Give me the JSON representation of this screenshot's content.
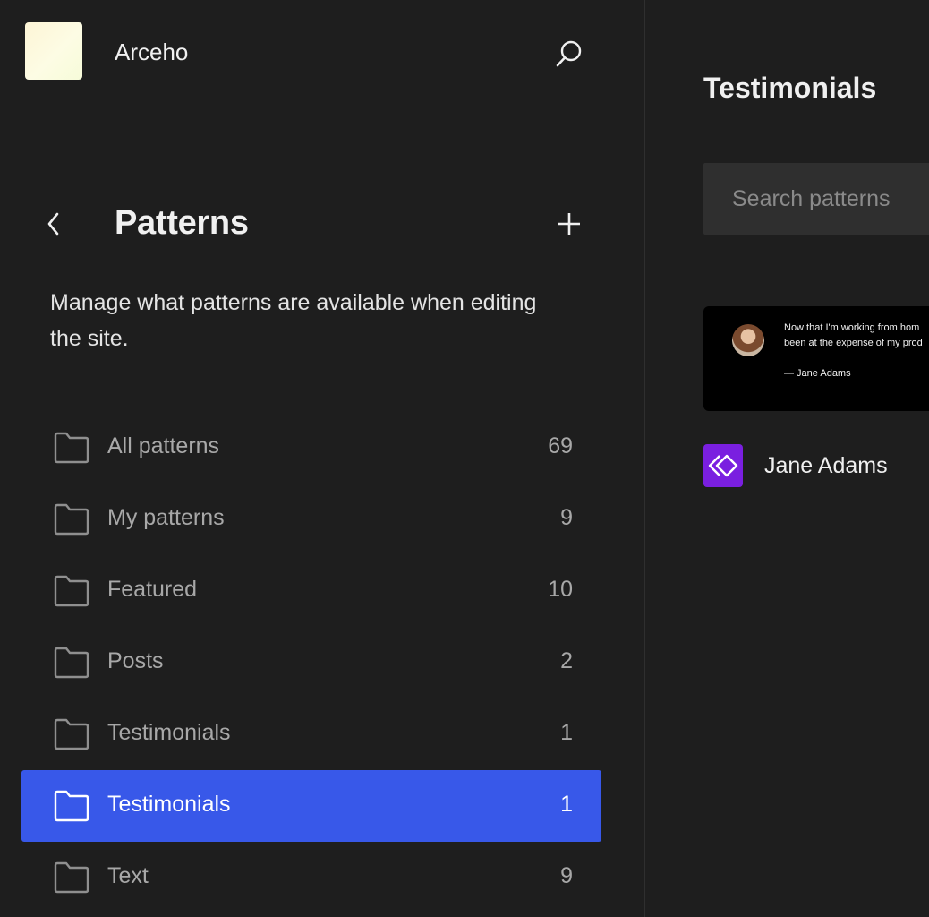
{
  "site": {
    "name": "Arceho"
  },
  "panel": {
    "title": "Patterns",
    "description": "Manage what patterns are available when editing the site."
  },
  "nav": {
    "items": [
      {
        "label": "All patterns",
        "count": "69"
      },
      {
        "label": "My patterns",
        "count": "9"
      },
      {
        "label": "Featured",
        "count": "10"
      },
      {
        "label": "Posts",
        "count": "2"
      },
      {
        "label": "Testimonials",
        "count": "1"
      },
      {
        "label": "Testimonials",
        "count": "1",
        "active": true
      },
      {
        "label": "Text",
        "count": "9"
      }
    ]
  },
  "main": {
    "title": "Testimonials",
    "search": {
      "placeholder": "Search patterns",
      "value": ""
    },
    "preview": {
      "quote_line1": "Now that I'm working from hom",
      "quote_line2": "been at the expense of my prod",
      "author": "— Jane Adams"
    },
    "pattern": {
      "name": "Jane Adams"
    }
  },
  "colors": {
    "background": "#1e1e1e",
    "accent": "#3858e9",
    "pattern_icon": "#7a1fe0"
  },
  "icons": {
    "search": "search-icon",
    "back": "chevron-left-icon",
    "add": "plus-icon",
    "folder": "folder-icon",
    "pattern": "synced-pattern-icon"
  }
}
